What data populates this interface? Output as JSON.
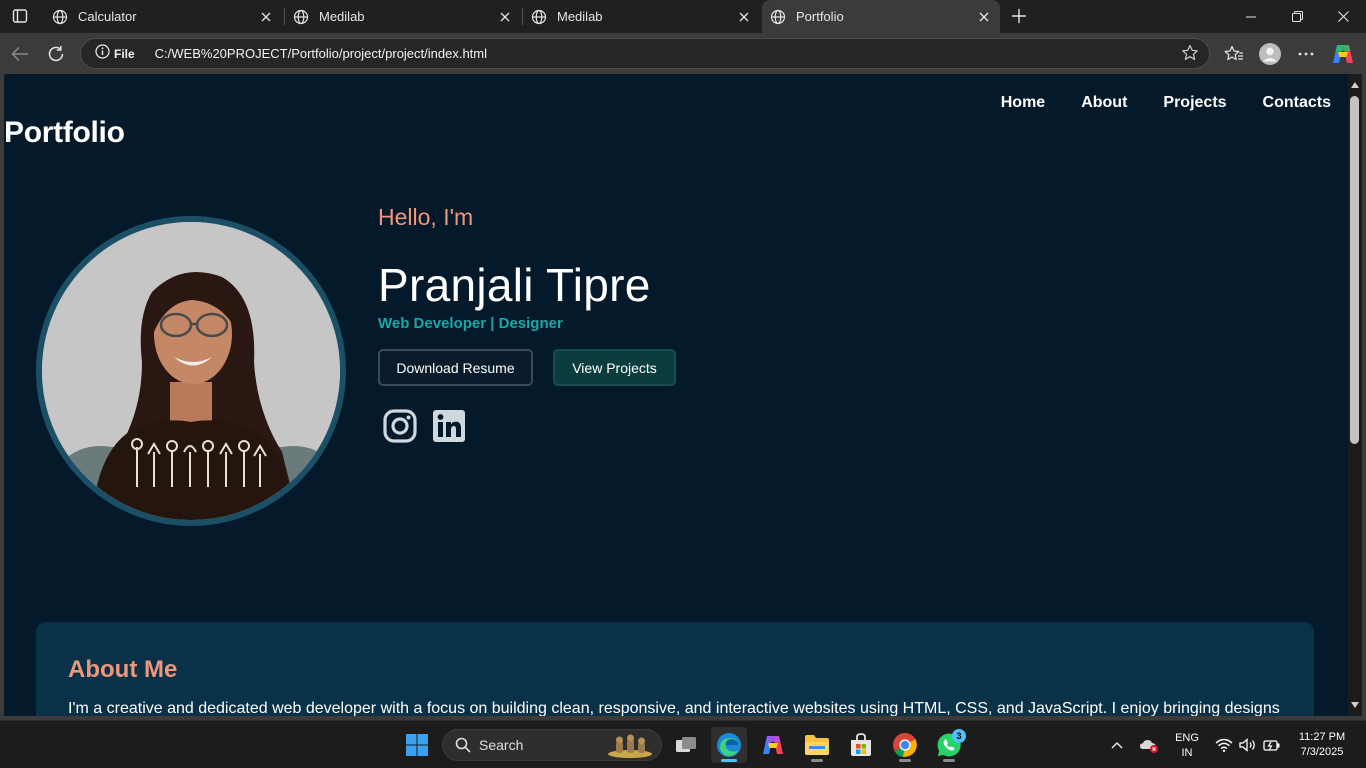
{
  "browser": {
    "tabs": [
      {
        "title": "Calculator",
        "active": false
      },
      {
        "title": "Medilab",
        "active": false
      },
      {
        "title": "Medilab",
        "active": false
      },
      {
        "title": "Portfolio",
        "active": true
      }
    ],
    "site_info_label": "File",
    "url": "C:/WEB%20PROJECT/Portfolio/project/project/index.html"
  },
  "site": {
    "brand": "Portfolio",
    "nav": [
      "Home",
      "About",
      "Projects",
      "Contacts"
    ],
    "hero": {
      "greeting": "Hello, I'm",
      "name": "Pranjali Tipre",
      "role": "Web Developer | Designer",
      "buttons": {
        "resume": "Download Resume",
        "projects": "View Projects"
      },
      "social": [
        "instagram-icon",
        "linkedin-icon"
      ]
    },
    "about": {
      "title": "About Me",
      "text": "I'm a creative and dedicated web developer with a focus on building clean, responsive, and interactive websites using HTML, CSS, and JavaScript. I enjoy bringing designs"
    },
    "colors": {
      "background": "#04192a",
      "accent": "#f0967a",
      "teal": "#1aa7a7",
      "card": "#093249"
    }
  },
  "taskbar": {
    "search_placeholder": "Search",
    "whatsapp_badge": "3",
    "lang_top": "ENG",
    "lang_bottom": "IN",
    "time": "11:27 PM",
    "date": "7/3/2025"
  }
}
